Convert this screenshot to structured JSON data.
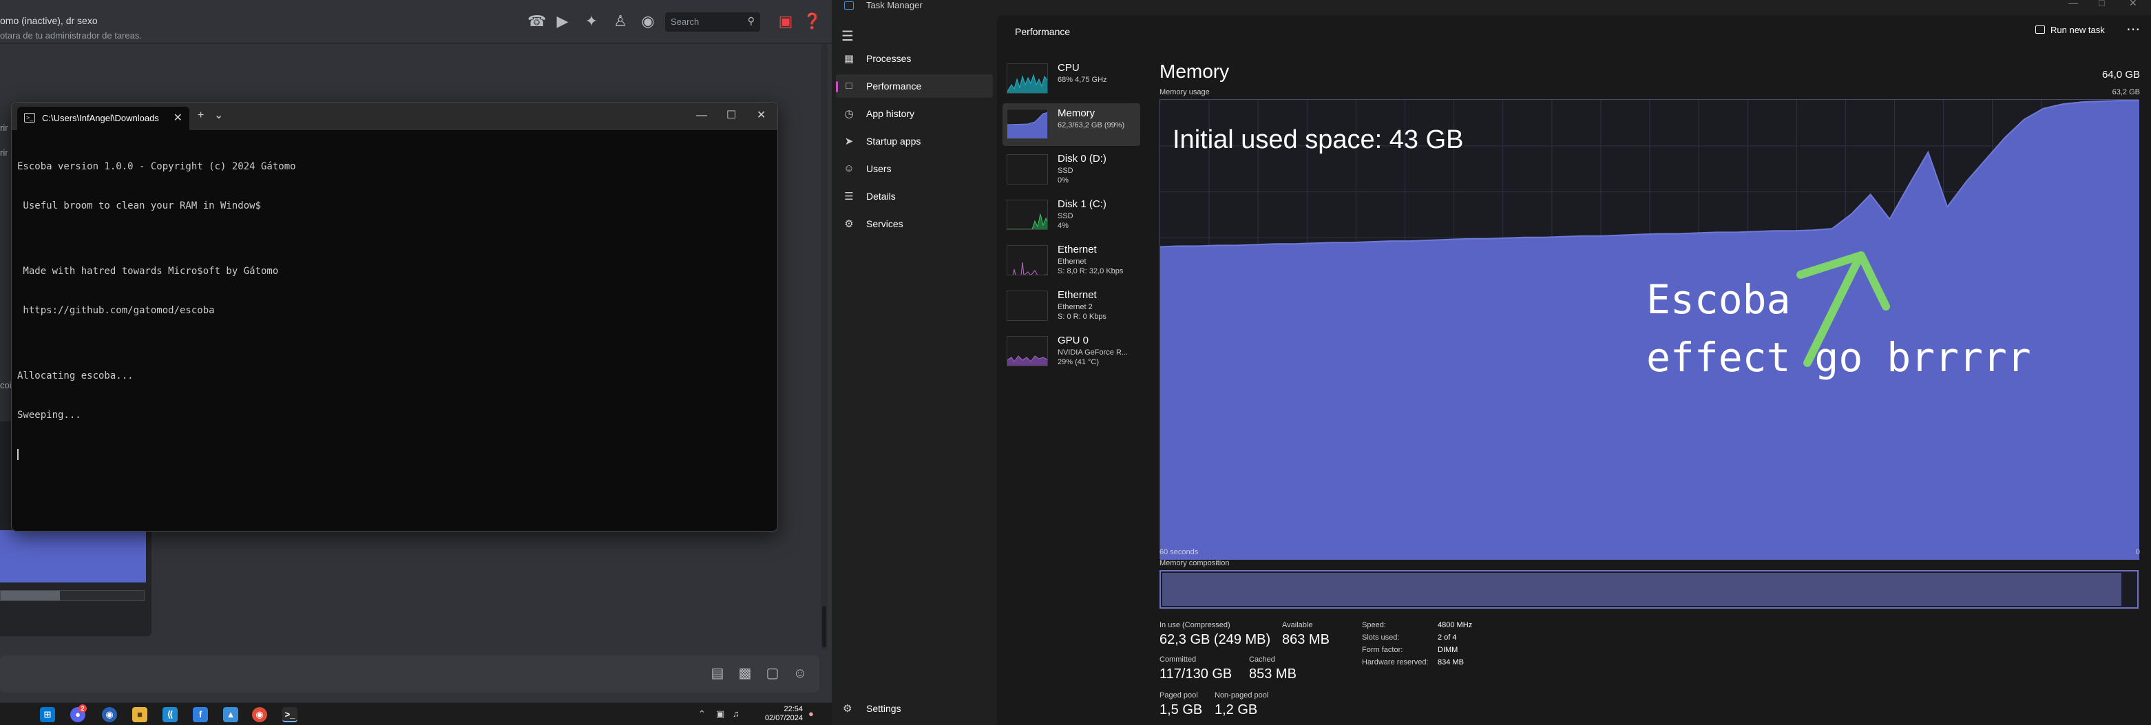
{
  "discord": {
    "header_title": "omo (inactive), dr sexo",
    "search_placeholder": "Search",
    "search_icon": "magnifier-icon",
    "snippet": "otara de tu administrador de tareas.",
    "side_cut_1": "rir",
    "side_cut_2": "rir",
    "side_cut_3": "coi",
    "icons": [
      "phone-icon",
      "video-icon",
      "pin-icon",
      "members-icon",
      "profile-icon",
      "inbox-icon",
      "help-icon"
    ],
    "composer_icons": [
      "gift-icon",
      "gif-icon",
      "sticker-icon",
      "emoji-icon"
    ]
  },
  "terminal": {
    "tab_title": "C:\\Users\\InfAngel\\Downloads",
    "new_tab": "+",
    "dropdown": "⌄",
    "minimize": "—",
    "maximize": "☐",
    "close": "✕",
    "lines": [
      "Escoba version 1.0.0 - Copyright (c) 2024 Gátomo",
      " Useful broom to clean your RAM in Window$",
      "",
      " Made with hatred towards Micro$oft by Gátomo",
      " https://github.com/gatomod/escoba",
      "",
      "Allocating escoba...",
      "Sweeping..."
    ]
  },
  "taskbar": {
    "apps": [
      "windows-start-icon",
      "discord-icon",
      "firefox-icon",
      "file-explorer-icon",
      "vscode-icon",
      "app-f-icon",
      "photos-icon",
      "chrome-icon",
      "terminal-icon"
    ],
    "discord_badge": "2",
    "time": "22:54",
    "date": "02/07/2024"
  },
  "task_manager": {
    "app_title": "Task Manager",
    "nav": [
      {
        "label": "Processes",
        "icon": "processes-icon"
      },
      {
        "label": "Performance",
        "icon": "performance-icon",
        "active": true
      },
      {
        "label": "App history",
        "icon": "history-icon"
      },
      {
        "label": "Startup apps",
        "icon": "startup-icon"
      },
      {
        "label": "Users",
        "icon": "users-icon"
      },
      {
        "label": "Details",
        "icon": "details-icon"
      },
      {
        "label": "Services",
        "icon": "services-icon"
      }
    ],
    "settings_label": "Settings",
    "page_title": "Performance",
    "run_new_task": "Run new task",
    "resources": [
      {
        "name": "CPU",
        "s1": "68% 4,75 GHz",
        "s2": ""
      },
      {
        "name": "Memory",
        "s1": "62,3/63,2 GB (99%)",
        "s2": "",
        "active": true
      },
      {
        "name": "Disk 0 (D:)",
        "s1": "SSD",
        "s2": "0%"
      },
      {
        "name": "Disk 1 (C:)",
        "s1": "SSD",
        "s2": "4%"
      },
      {
        "name": "Ethernet",
        "s1": "Ethernet",
        "s2": "S: 8,0  R: 32,0 Kbps"
      },
      {
        "name": "Ethernet",
        "s1": "Ethernet 2",
        "s2": "S: 0  R: 0 Kbps"
      },
      {
        "name": "GPU 0",
        "s1": "NVIDIA GeForce R...",
        "s2": "29% (41 °C)"
      }
    ],
    "memory": {
      "title": "Memory",
      "total": "64,0 GB",
      "usage_label": "Memory usage",
      "usage_max": "63,2 GB",
      "time_left": "60 seconds",
      "time_right": "0",
      "composition_label": "Memory composition",
      "composition_in_use_fraction": 0.985,
      "stats": {
        "in_use_label": "In use (Compressed)",
        "in_use": "62,3 GB (249 MB)",
        "available_label": "Available",
        "available": "863 MB",
        "committed_label": "Committed",
        "committed": "117/130 GB",
        "cached_label": "Cached",
        "cached": "853 MB",
        "paged_label": "Paged pool",
        "paged": "1,5 GB",
        "nonpaged_label": "Non-paged pool",
        "nonpaged": "1,2 GB"
      },
      "details": [
        {
          "k": "Speed:",
          "v": "4800 MHz"
        },
        {
          "k": "Slots used:",
          "v": "2 of 4"
        },
        {
          "k": "Form factor:",
          "v": "DIMM"
        },
        {
          "k": "Hardware reserved:",
          "v": "834 MB"
        }
      ]
    },
    "annotations": {
      "initial": "Initial used space: 43 GB",
      "effect_line1": "Escoba",
      "effect_line2": "effect go brrrrr",
      "arrow_color": "#7ed46a"
    }
  },
  "chart_data": {
    "type": "area",
    "title": "Memory usage",
    "xlabel": "",
    "ylabel": "",
    "x_range": [
      "60 seconds",
      "0"
    ],
    "ylim": [
      0,
      63.2
    ],
    "unit": "GB",
    "series": [
      {
        "values": [
          43.0,
          43.1,
          43.1,
          43.2,
          43.2,
          43.3,
          43.4,
          43.4,
          43.5,
          43.6,
          43.6,
          43.7,
          43.8,
          43.8,
          43.9,
          44.0,
          44.1,
          44.1,
          44.2,
          44.3,
          44.3,
          44.4,
          44.5,
          44.5,
          44.6,
          44.7,
          44.8,
          44.8,
          44.9,
          45.0,
          45.0,
          45.1,
          45.2,
          45.2,
          45.3,
          45.5,
          47.5,
          50.2,
          46.8,
          51.5,
          56.0,
          48.5,
          52.0,
          55.0,
          58.0,
          60.5,
          62.0,
          62.6,
          62.9,
          63.0,
          63.1,
          63.1
        ]
      }
    ],
    "fill_color": "#5a64c4",
    "line_color": "#6f7ad6",
    "grid": true
  }
}
